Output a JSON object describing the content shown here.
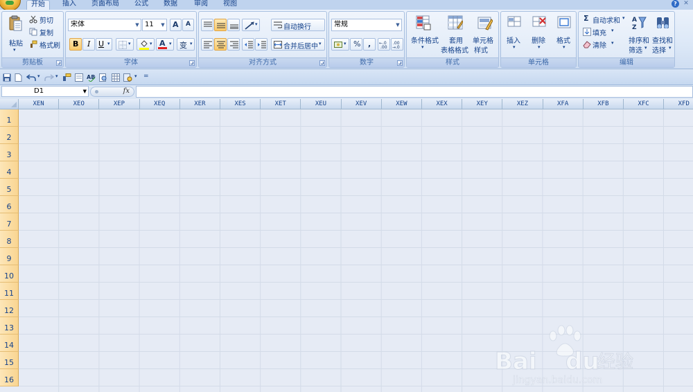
{
  "tabs": [
    {
      "id": "home",
      "label": "开始",
      "active": true
    },
    {
      "id": "insert",
      "label": "插入",
      "active": false
    },
    {
      "id": "page_layout",
      "label": "页面布局",
      "active": false
    },
    {
      "id": "formulas",
      "label": "公式",
      "active": false
    },
    {
      "id": "data",
      "label": "数据",
      "active": false
    },
    {
      "id": "review",
      "label": "审阅",
      "active": false
    },
    {
      "id": "view",
      "label": "视图",
      "active": false
    }
  ],
  "clipboard": {
    "group": "剪贴板",
    "paste": "粘贴",
    "cut": "剪切",
    "copy": "复制",
    "format_painter": "格式刷"
  },
  "font": {
    "group": "字体",
    "name": "宋体",
    "size": "11",
    "grow": "A",
    "shrink": "A",
    "bold": "B",
    "italic": "I",
    "underline": "U",
    "phonetic": "变",
    "highlight_color": "#ffff00",
    "font_color": "#e02020"
  },
  "alignment": {
    "group": "对齐方式",
    "wrap_text": "自动换行",
    "merge_center": "合并后居中"
  },
  "number": {
    "group": "数字",
    "format": "常规",
    "currency": "¥",
    "percent": "%",
    "comma": ",",
    "inc_decimal": ".0→.00",
    "dec_decimal": ".00→.0"
  },
  "styles": {
    "group": "样式",
    "conditional_line1": "条件格式",
    "table_line1": "套用",
    "table_line2": "表格格式",
    "cell_line1": "单元格",
    "cell_line2": "样式"
  },
  "cells": {
    "group": "单元格",
    "insert": "插入",
    "delete": "删除",
    "format": "格式"
  },
  "editing": {
    "group": "编辑",
    "autosum": "自动求和",
    "fill": "填充",
    "clear": "清除",
    "sort_line1": "排序和",
    "sort_line2": "筛选",
    "find_line1": "查找和",
    "find_line2": "选择"
  },
  "formula_bar": {
    "name_box": "D1",
    "fx": "fx",
    "value": ""
  },
  "columns": [
    "XEN",
    "XEO",
    "XEP",
    "XEQ",
    "XER",
    "XES",
    "XET",
    "XEU",
    "XEV",
    "XEW",
    "XEX",
    "XEY",
    "XEZ",
    "XFA",
    "XFB",
    "XFC",
    "XFD"
  ],
  "rows": [
    "1",
    "2",
    "3",
    "4",
    "5",
    "6",
    "7",
    "8",
    "9",
    "10",
    "11",
    "12",
    "13",
    "14",
    "15",
    "16"
  ],
  "watermark": {
    "brand": "Bai",
    "brand2": "du",
    "cn": "经验",
    "url": "jingyan.baidu.com"
  },
  "colors": {
    "ribbon": "#dce8f7",
    "grid": "#e6ebf5",
    "row_header": "#f9d591",
    "col_header": "#c9d9ee",
    "text": "#15428b"
  }
}
